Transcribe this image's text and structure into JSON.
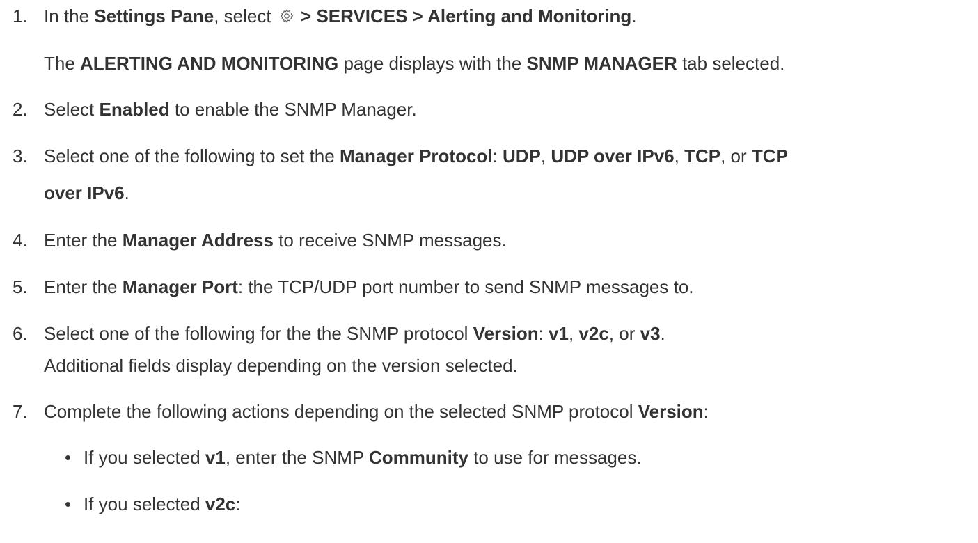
{
  "steps": [
    {
      "number": "1.",
      "lines": [
        {
          "parts": [
            {
              "t": "In the ",
              "b": false
            },
            {
              "t": "Settings Pane",
              "b": true
            },
            {
              "t": ", select ",
              "b": false
            },
            {
              "icon": "gear-icon"
            },
            {
              "t": " > SERVICES > Alerting and Monitoring",
              "b": true
            },
            {
              "t": ".",
              "b": false
            }
          ]
        },
        {
          "parts": [
            {
              "t": "The ",
              "b": false
            },
            {
              "t": "ALERTING AND MONITORING",
              "b": true
            },
            {
              "t": " page displays with the ",
              "b": false
            },
            {
              "t": "SNMP MANAGER",
              "b": true
            },
            {
              "t": " tab selected.",
              "b": false
            }
          ]
        }
      ]
    },
    {
      "number": "2.",
      "lines": [
        {
          "parts": [
            {
              "t": "Select ",
              "b": false
            },
            {
              "t": "Enabled",
              "b": true
            },
            {
              "t": " to enable the SNMP Manager.",
              "b": false
            }
          ]
        }
      ]
    },
    {
      "number": "3.",
      "lines": [
        {
          "parts": [
            {
              "t": "Select one of the following to set the ",
              "b": false
            },
            {
              "t": "Manager Protocol",
              "b": true
            },
            {
              "t": ": ",
              "b": false
            },
            {
              "t": "UDP",
              "b": true
            },
            {
              "t": ", ",
              "b": false
            },
            {
              "t": "UDP over IPv6",
              "b": true
            },
            {
              "t": ", ",
              "b": false
            },
            {
              "t": "TCP",
              "b": true
            },
            {
              "t": ", or ",
              "b": false
            },
            {
              "t": "TCP",
              "b": true
            }
          ]
        },
        {
          "parts": [
            {
              "t": "over IPv6",
              "b": true
            },
            {
              "t": ".",
              "b": false
            }
          ]
        }
      ]
    },
    {
      "number": "4.",
      "lines": [
        {
          "parts": [
            {
              "t": "Enter the ",
              "b": false
            },
            {
              "t": "Manager Address",
              "b": true
            },
            {
              "t": " to receive SNMP messages.",
              "b": false
            }
          ]
        }
      ]
    },
    {
      "number": "5.",
      "lines": [
        {
          "parts": [
            {
              "t": "Enter the ",
              "b": false
            },
            {
              "t": "Manager Port",
              "b": true
            },
            {
              "t": ": the TCP/UDP port number to send SNMP messages to.",
              "b": false
            }
          ]
        }
      ]
    },
    {
      "number": "6.",
      "lines": [
        {
          "parts": [
            {
              "t": "Select one of the following for the the SNMP protocol ",
              "b": false
            },
            {
              "t": "Version",
              "b": true
            },
            {
              "t": ": ",
              "b": false
            },
            {
              "t": "v1",
              "b": true
            },
            {
              "t": ", ",
              "b": false
            },
            {
              "t": "v2c",
              "b": true
            },
            {
              "t": ", or ",
              "b": false
            },
            {
              "t": "v3",
              "b": true
            },
            {
              "t": ".",
              "b": false
            }
          ]
        },
        {
          "parts": [
            {
              "t": "Additional fields display depending on the version selected.",
              "b": false
            }
          ]
        }
      ]
    },
    {
      "number": "7.",
      "lines": [
        {
          "parts": [
            {
              "t": "Complete the following actions depending on the selected SNMP protocol ",
              "b": false
            },
            {
              "t": "Version",
              "b": true
            },
            {
              "t": ":",
              "b": false
            }
          ]
        }
      ]
    }
  ],
  "bullets": [
    {
      "symbol": "•",
      "parts": [
        {
          "t": "If you selected ",
          "b": false
        },
        {
          "t": "v1",
          "b": true
        },
        {
          "t": ", enter the SNMP ",
          "b": false
        },
        {
          "t": "Community",
          "b": true
        },
        {
          "t": " to use for messages.",
          "b": false
        }
      ]
    },
    {
      "symbol": "•",
      "parts": [
        {
          "t": "If you selected ",
          "b": false
        },
        {
          "t": "v2c",
          "b": true
        },
        {
          "t": ":",
          "b": false
        }
      ]
    }
  ]
}
